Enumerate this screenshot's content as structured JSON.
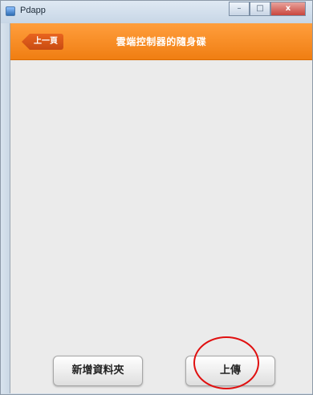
{
  "window": {
    "title": "Pdapp",
    "controls": {
      "minimize_icon": "minimize-icon",
      "maximize_icon": "maximize-icon",
      "close_icon": "close-icon",
      "minimize_glyph": "–",
      "maximize_glyph": "□",
      "close_glyph": "x"
    }
  },
  "header": {
    "back_label": "上一頁",
    "title": "雲端控制器的隨身碟",
    "color": "#f4871f"
  },
  "footer": {
    "new_folder_label": "新增資料夾",
    "upload_label": "上傳"
  },
  "annotation": {
    "highlight_color": "#e01010"
  }
}
